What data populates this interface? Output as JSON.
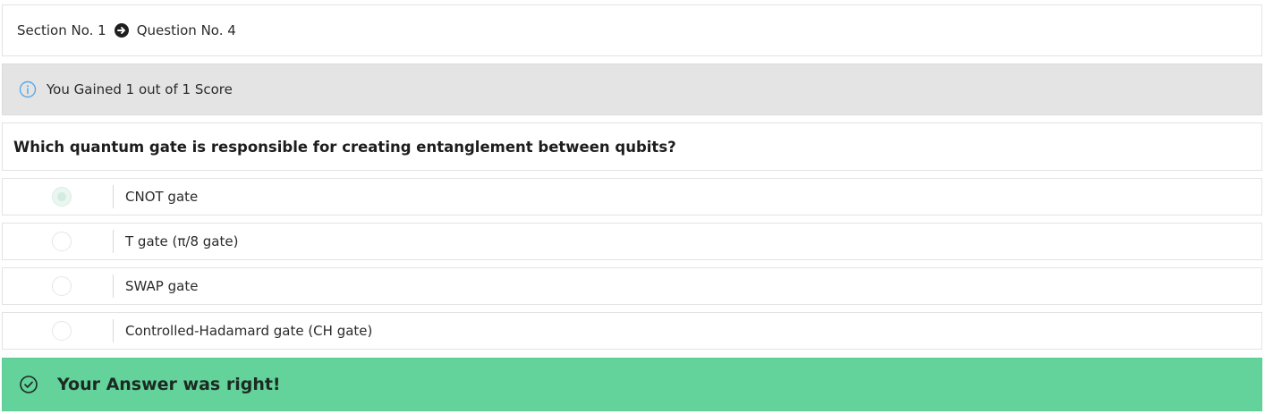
{
  "breadcrumb": {
    "section": "Section No. 1",
    "question": "Question No. 4"
  },
  "score": {
    "text": "You Gained 1 out of 1 Score"
  },
  "question": {
    "text": "Which quantum gate is responsible for creating entanglement between qubits?"
  },
  "options": [
    {
      "label": "CNOT gate",
      "selected": true
    },
    {
      "label": "T gate (π/8 gate)",
      "selected": false
    },
    {
      "label": "SWAP gate",
      "selected": false
    },
    {
      "label": "Controlled-Hadamard gate (CH gate)",
      "selected": false
    }
  ],
  "result": {
    "text": "Your Answer was right!"
  },
  "colors": {
    "success": "#63d29b",
    "info": "#5aa9e6",
    "score_bg": "#e4e4e4"
  },
  "icons": {
    "breadcrumb_separator": "arrow-circle-right-icon",
    "score": "info-circle-icon",
    "result": "check-circle-icon"
  }
}
